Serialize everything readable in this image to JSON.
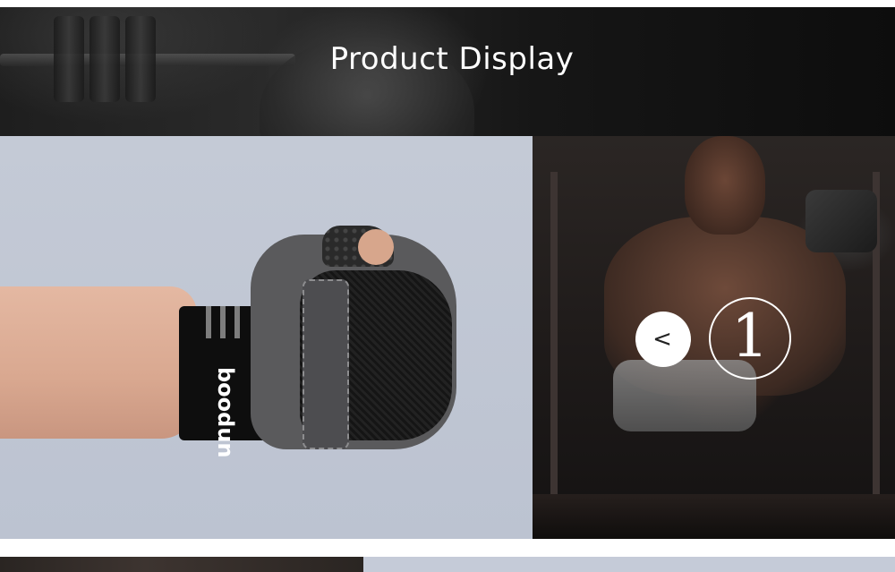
{
  "header": {
    "title": "Product Display"
  },
  "product": {
    "brand": "boodun"
  },
  "carousel": {
    "prev_label": "<",
    "current_index": "1"
  },
  "colors": {
    "header_bg": "#161616",
    "glove_panel_bg": "#c4cad6",
    "gym_panel_bg": "#1f1b1a",
    "accent": "#ffffff"
  },
  "icons": {
    "prev": "chevron-left-icon"
  }
}
